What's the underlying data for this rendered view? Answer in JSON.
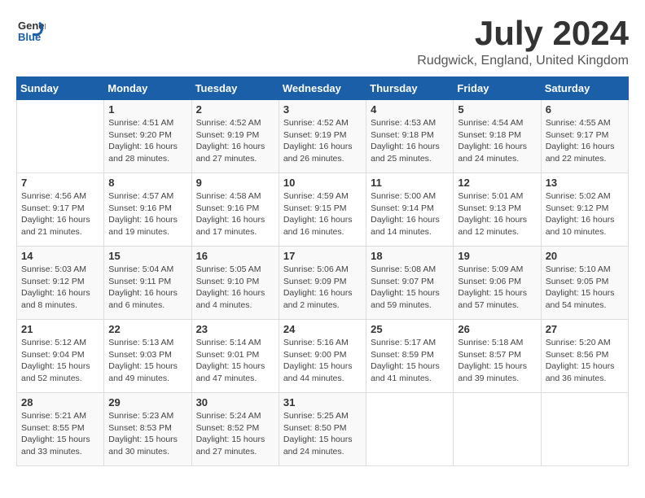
{
  "header": {
    "logo_general": "General",
    "logo_blue": "Blue",
    "month": "July 2024",
    "location": "Rudgwick, England, United Kingdom"
  },
  "days_of_week": [
    "Sunday",
    "Monday",
    "Tuesday",
    "Wednesday",
    "Thursday",
    "Friday",
    "Saturday"
  ],
  "weeks": [
    [
      {
        "day": "",
        "info": ""
      },
      {
        "day": "1",
        "info": "Sunrise: 4:51 AM\nSunset: 9:20 PM\nDaylight: 16 hours\nand 28 minutes."
      },
      {
        "day": "2",
        "info": "Sunrise: 4:52 AM\nSunset: 9:19 PM\nDaylight: 16 hours\nand 27 minutes."
      },
      {
        "day": "3",
        "info": "Sunrise: 4:52 AM\nSunset: 9:19 PM\nDaylight: 16 hours\nand 26 minutes."
      },
      {
        "day": "4",
        "info": "Sunrise: 4:53 AM\nSunset: 9:18 PM\nDaylight: 16 hours\nand 25 minutes."
      },
      {
        "day": "5",
        "info": "Sunrise: 4:54 AM\nSunset: 9:18 PM\nDaylight: 16 hours\nand 24 minutes."
      },
      {
        "day": "6",
        "info": "Sunrise: 4:55 AM\nSunset: 9:17 PM\nDaylight: 16 hours\nand 22 minutes."
      }
    ],
    [
      {
        "day": "7",
        "info": "Sunrise: 4:56 AM\nSunset: 9:17 PM\nDaylight: 16 hours\nand 21 minutes."
      },
      {
        "day": "8",
        "info": "Sunrise: 4:57 AM\nSunset: 9:16 PM\nDaylight: 16 hours\nand 19 minutes."
      },
      {
        "day": "9",
        "info": "Sunrise: 4:58 AM\nSunset: 9:16 PM\nDaylight: 16 hours\nand 17 minutes."
      },
      {
        "day": "10",
        "info": "Sunrise: 4:59 AM\nSunset: 9:15 PM\nDaylight: 16 hours\nand 16 minutes."
      },
      {
        "day": "11",
        "info": "Sunrise: 5:00 AM\nSunset: 9:14 PM\nDaylight: 16 hours\nand 14 minutes."
      },
      {
        "day": "12",
        "info": "Sunrise: 5:01 AM\nSunset: 9:13 PM\nDaylight: 16 hours\nand 12 minutes."
      },
      {
        "day": "13",
        "info": "Sunrise: 5:02 AM\nSunset: 9:12 PM\nDaylight: 16 hours\nand 10 minutes."
      }
    ],
    [
      {
        "day": "14",
        "info": "Sunrise: 5:03 AM\nSunset: 9:12 PM\nDaylight: 16 hours\nand 8 minutes."
      },
      {
        "day": "15",
        "info": "Sunrise: 5:04 AM\nSunset: 9:11 PM\nDaylight: 16 hours\nand 6 minutes."
      },
      {
        "day": "16",
        "info": "Sunrise: 5:05 AM\nSunset: 9:10 PM\nDaylight: 16 hours\nand 4 minutes."
      },
      {
        "day": "17",
        "info": "Sunrise: 5:06 AM\nSunset: 9:09 PM\nDaylight: 16 hours\nand 2 minutes."
      },
      {
        "day": "18",
        "info": "Sunrise: 5:08 AM\nSunset: 9:07 PM\nDaylight: 15 hours\nand 59 minutes."
      },
      {
        "day": "19",
        "info": "Sunrise: 5:09 AM\nSunset: 9:06 PM\nDaylight: 15 hours\nand 57 minutes."
      },
      {
        "day": "20",
        "info": "Sunrise: 5:10 AM\nSunset: 9:05 PM\nDaylight: 15 hours\nand 54 minutes."
      }
    ],
    [
      {
        "day": "21",
        "info": "Sunrise: 5:12 AM\nSunset: 9:04 PM\nDaylight: 15 hours\nand 52 minutes."
      },
      {
        "day": "22",
        "info": "Sunrise: 5:13 AM\nSunset: 9:03 PM\nDaylight: 15 hours\nand 49 minutes."
      },
      {
        "day": "23",
        "info": "Sunrise: 5:14 AM\nSunset: 9:01 PM\nDaylight: 15 hours\nand 47 minutes."
      },
      {
        "day": "24",
        "info": "Sunrise: 5:16 AM\nSunset: 9:00 PM\nDaylight: 15 hours\nand 44 minutes."
      },
      {
        "day": "25",
        "info": "Sunrise: 5:17 AM\nSunset: 8:59 PM\nDaylight: 15 hours\nand 41 minutes."
      },
      {
        "day": "26",
        "info": "Sunrise: 5:18 AM\nSunset: 8:57 PM\nDaylight: 15 hours\nand 39 minutes."
      },
      {
        "day": "27",
        "info": "Sunrise: 5:20 AM\nSunset: 8:56 PM\nDaylight: 15 hours\nand 36 minutes."
      }
    ],
    [
      {
        "day": "28",
        "info": "Sunrise: 5:21 AM\nSunset: 8:55 PM\nDaylight: 15 hours\nand 33 minutes."
      },
      {
        "day": "29",
        "info": "Sunrise: 5:23 AM\nSunset: 8:53 PM\nDaylight: 15 hours\nand 30 minutes."
      },
      {
        "day": "30",
        "info": "Sunrise: 5:24 AM\nSunset: 8:52 PM\nDaylight: 15 hours\nand 27 minutes."
      },
      {
        "day": "31",
        "info": "Sunrise: 5:25 AM\nSunset: 8:50 PM\nDaylight: 15 hours\nand 24 minutes."
      },
      {
        "day": "",
        "info": ""
      },
      {
        "day": "",
        "info": ""
      },
      {
        "day": "",
        "info": ""
      }
    ]
  ]
}
